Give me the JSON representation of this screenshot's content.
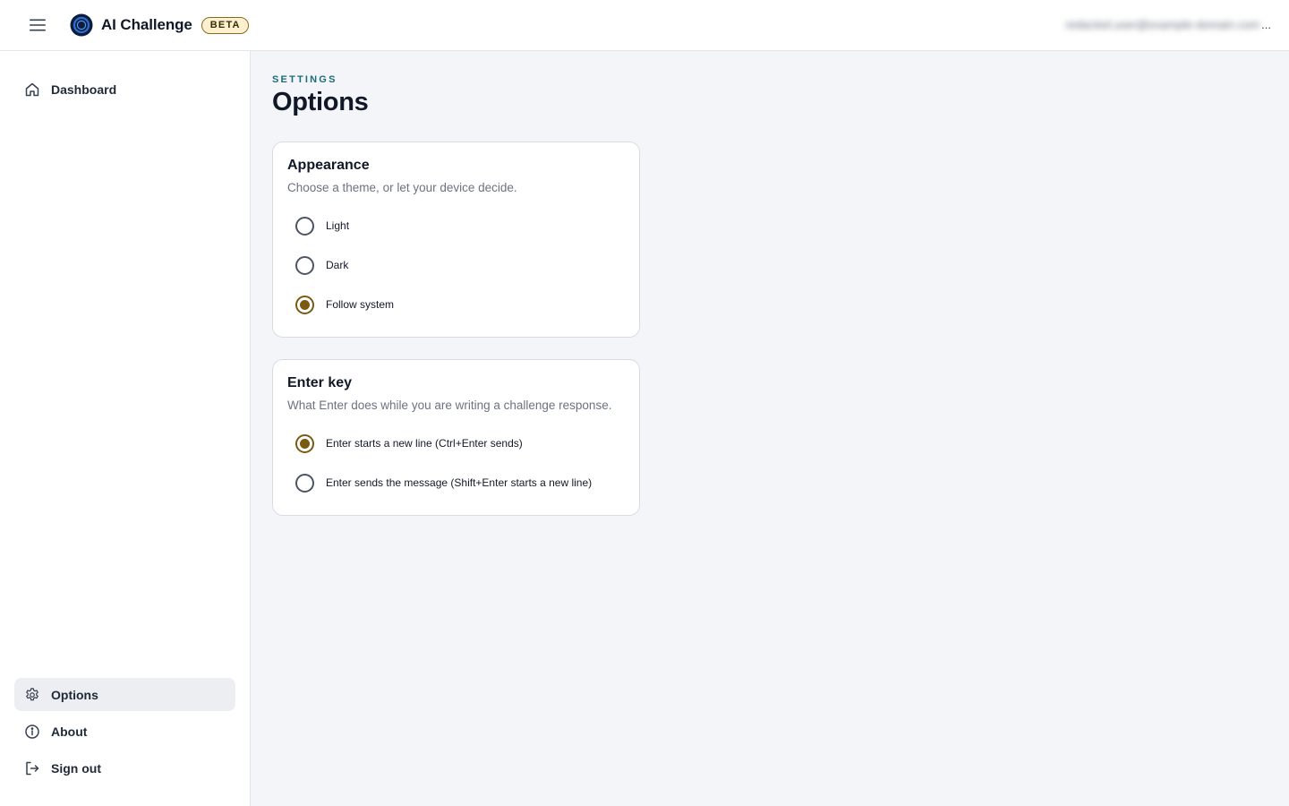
{
  "header": {
    "app_title": "AI Challenge",
    "badge": "BETA",
    "account_name": "redacted.user@example-domain.com",
    "account_ellipsis": "..."
  },
  "sidebar": {
    "top_items": [
      {
        "label": "Dashboard",
        "icon": "home-icon"
      }
    ],
    "bottom_items": [
      {
        "label": "Options",
        "icon": "gear-icon",
        "active": true
      },
      {
        "label": "About",
        "icon": "info-icon"
      },
      {
        "label": "Sign out",
        "icon": "sign-out-icon"
      }
    ]
  },
  "main": {
    "eyebrow": "SETTINGS",
    "title": "Options",
    "sections": [
      {
        "title": "Appearance",
        "description": "Choose a theme, or let your device decide.",
        "options": [
          {
            "label": "Light",
            "checked": false
          },
          {
            "label": "Dark",
            "checked": false
          },
          {
            "label": "Follow system",
            "checked": true
          }
        ]
      },
      {
        "title": "Enter key",
        "description": "What Enter does while you are writing a challenge response.",
        "options": [
          {
            "label": "Enter starts a new line (Ctrl+Enter sends)",
            "checked": true
          },
          {
            "label": "Enter sends the message (Shift+Enter starts a new line)",
            "checked": false
          }
        ]
      }
    ]
  },
  "colors": {
    "accent": "#7a5a10",
    "eyebrow": "#1f6a78",
    "page_background": "#f3f5f9",
    "active_nav": "#eceef1"
  }
}
